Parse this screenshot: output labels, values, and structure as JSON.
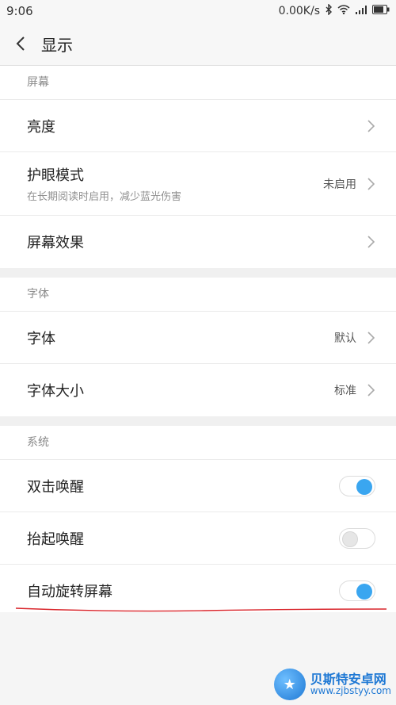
{
  "status": {
    "time": "9:06",
    "speed": "0.00K/s",
    "icons": [
      "bluetooth-icon",
      "wifi-icon",
      "signal-icon",
      "battery-icon"
    ]
  },
  "header": {
    "title": "显示"
  },
  "sections": {
    "screen": {
      "title": "屏幕",
      "brightness": {
        "label": "亮度"
      },
      "eye": {
        "label": "护眼模式",
        "sub": "在长期阅读时启用，减少蓝光伤害",
        "value": "未启用"
      },
      "effect": {
        "label": "屏幕效果"
      }
    },
    "font": {
      "title": "字体",
      "font": {
        "label": "字体",
        "value": "默认"
      },
      "size": {
        "label": "字体大小",
        "value": "标准"
      }
    },
    "system": {
      "title": "系统",
      "double_tap": {
        "label": "双击唤醒",
        "enabled": true
      },
      "lift": {
        "label": "抬起唤醒",
        "enabled": false
      },
      "rotate": {
        "label": "自动旋转屏幕",
        "enabled": true
      }
    }
  },
  "watermark": {
    "title": "贝斯特安卓网",
    "url": "www.zjbstyy.com"
  },
  "colors": {
    "accent": "#3aa6f0",
    "annotation": "#d9262c",
    "watermark": "#1e78d4"
  }
}
